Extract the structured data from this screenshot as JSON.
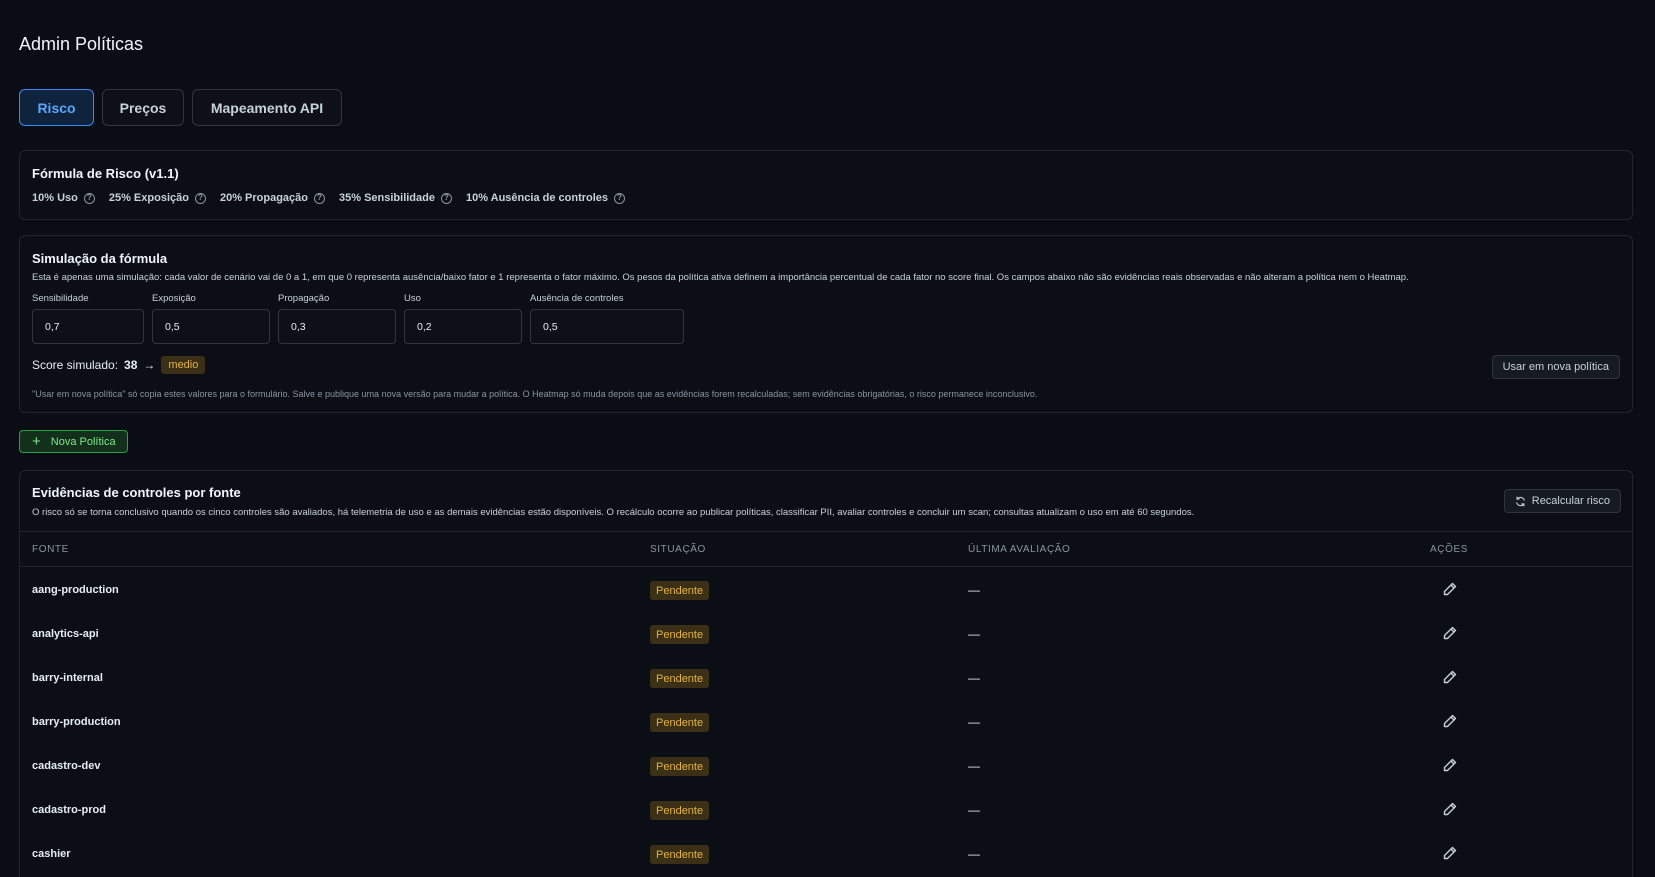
{
  "page": {
    "title": "Admin Políticas"
  },
  "tabs": [
    {
      "label": "Risco",
      "active": true
    },
    {
      "label": "Preços",
      "active": false
    },
    {
      "label": "Mapeamento API",
      "active": false
    }
  ],
  "formula": {
    "title": "Fórmula de Risco (v1.1)",
    "weights": [
      {
        "label": "10% Uso"
      },
      {
        "label": "25% Exposição"
      },
      {
        "label": "20% Propagação"
      },
      {
        "label": "35% Sensibilidade"
      },
      {
        "label": "10% Ausência de controles"
      }
    ]
  },
  "simulation": {
    "title": "Simulação da fórmula",
    "description": "Esta é apenas uma simulação: cada valor de cenário vai de 0 a 1, em que 0 representa ausência/baixo fator e 1 representa o fator máximo. Os pesos da política ativa definem a importância percentual de cada fator no score final. Os campos abaixo não são evidências reais observadas e não alteram a política nem o Heatmap.",
    "fields": [
      {
        "label": "Sensibilidade",
        "value": "0,7"
      },
      {
        "label": "Exposição",
        "value": "0,5"
      },
      {
        "label": "Propagação",
        "value": "0,3"
      },
      {
        "label": "Uso",
        "value": "0,2"
      },
      {
        "label": "Ausência de controles",
        "value": "0,5"
      }
    ],
    "score_label": "Score simulado:",
    "score_value": "38",
    "score_arrow": "→",
    "score_level": "medio",
    "use_button": "Usar em nova política",
    "note": "\"Usar em nova política\" só copia estes valores para o formulário. Salve e publique uma nova versão para mudar a política. O Heatmap só muda depois que as evidências forem recalculadas; sem evidências obrigatórias, o risco permanece inconclusivo."
  },
  "new_policy_button": "Nova Política",
  "evidence": {
    "title": "Evidências de controles por fonte",
    "description": "O risco só se torna conclusivo quando os cinco controles são avaliados, há telemetria de uso e as demais evidências estão disponíveis. O recálculo ocorre ao publicar políticas, classificar PII, avaliar controles e concluir um scan; consultas atualizam o uso em até 60 segundos.",
    "recalc_button": "Recalcular risco",
    "columns": {
      "source": "FONTE",
      "status": "SITUAÇÃO",
      "last_eval": "ÚLTIMA AVALIAÇÃO",
      "actions": "AÇÕES"
    },
    "rows": [
      {
        "source": "aang-production",
        "status": "Pendente",
        "last_eval": "—"
      },
      {
        "source": "analytics-api",
        "status": "Pendente",
        "last_eval": "—"
      },
      {
        "source": "barry-internal",
        "status": "Pendente",
        "last_eval": "—"
      },
      {
        "source": "barry-production",
        "status": "Pendente",
        "last_eval": "—"
      },
      {
        "source": "cadastro-dev",
        "status": "Pendente",
        "last_eval": "—"
      },
      {
        "source": "cadastro-prod",
        "status": "Pendente",
        "last_eval": "—"
      },
      {
        "source": "cashier",
        "status": "Pendente",
        "last_eval": "—"
      }
    ]
  },
  "icons": {
    "help": "question-circle-icon",
    "plus": "plus-icon",
    "refresh": "refresh-icon",
    "edit": "pencil-icon"
  },
  "colors": {
    "accent": "#58a6ff",
    "success": "#7ee787",
    "warning": "#e3b341",
    "background": "#0a0d13"
  }
}
